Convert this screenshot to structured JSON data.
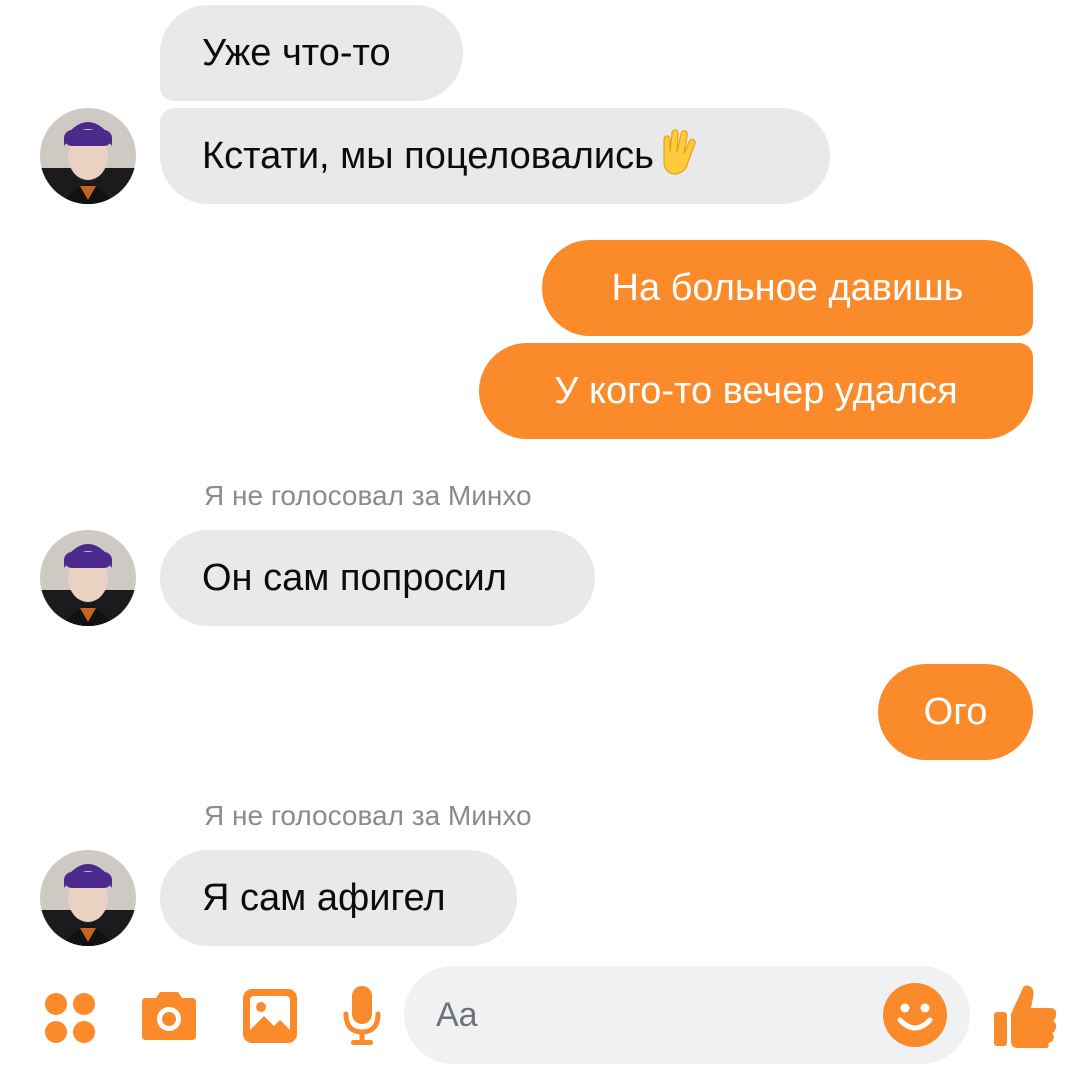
{
  "colors": {
    "accent": "#fa8a2a",
    "incoming_bubble": "#e9e9eb",
    "input_bg": "#f0f1f3",
    "meta_text": "#8a8a8f"
  },
  "messages": [
    {
      "side": "incoming",
      "text": "Уже что-то"
    },
    {
      "side": "incoming",
      "text": "Кстати, мы поцеловались",
      "emoji": "vulcan-salute-emoji"
    },
    {
      "side": "outgoing",
      "text": "На больное давишь"
    },
    {
      "side": "outgoing",
      "text": "У кого-то вечер удался"
    },
    {
      "side": "incoming",
      "reply_to": "Я не голосовал за Минхо",
      "text": "Он сам попросил"
    },
    {
      "side": "outgoing",
      "text": "Ого"
    },
    {
      "side": "incoming",
      "reply_to": "Я не голосовал за Минхо",
      "text": "Я сам афигел"
    }
  ],
  "composer": {
    "placeholder": "Aa",
    "icons": [
      "apps-icon",
      "camera-icon",
      "gallery-icon",
      "microphone-icon",
      "emoji-icon",
      "thumbs-up-icon"
    ]
  }
}
